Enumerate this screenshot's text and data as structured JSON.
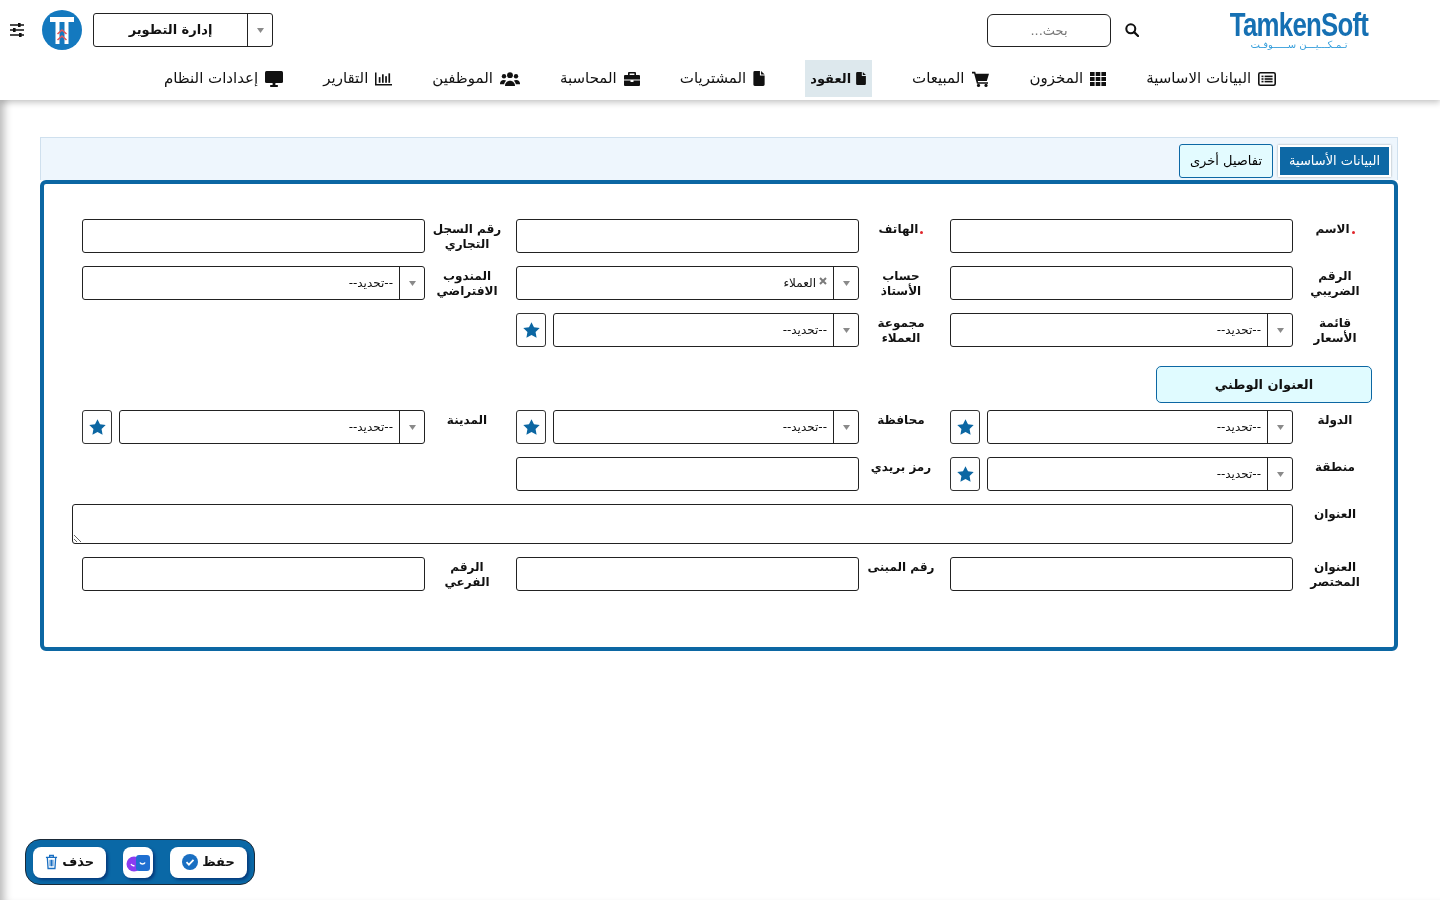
{
  "header": {
    "brand": {
      "name": "TamkenSoft",
      "tagline": "تـمـكـــيـــن ســـــوفـت"
    },
    "search": {
      "placeholder": "بحث..."
    },
    "department": {
      "value": "إدارة التطوير"
    }
  },
  "nav": [
    {
      "label": "البيانات الاساسية",
      "selected": false
    },
    {
      "label": "المخزون",
      "selected": false
    },
    {
      "label": "المبيعات",
      "selected": false
    },
    {
      "label": "العقود",
      "selected": true
    },
    {
      "label": "المشتريات",
      "selected": false
    },
    {
      "label": "المحاسبة",
      "selected": false
    },
    {
      "label": "الموظفين",
      "selected": false
    },
    {
      "label": "التقارير",
      "selected": false
    },
    {
      "label": "إعدادات النظام",
      "selected": false
    }
  ],
  "tabs": [
    {
      "label": "البيانات الأساسية",
      "selected": true
    },
    {
      "label": "تفاصيل أخرى",
      "selected": false
    }
  ],
  "form": {
    "groups": [
      {
        "rows": [
          [
            {
              "label": "الاسم",
              "kind": "input",
              "required": true
            },
            {
              "label": "الهاتف",
              "kind": "input",
              "required": true
            },
            {
              "label": "رقم السجل التجاري",
              "kind": "input",
              "required": false
            }
          ],
          [
            {
              "label": "الرقم الضريبي",
              "kind": "input",
              "required": false
            },
            {
              "label": "حساب الأستاذ",
              "kind": "select",
              "value": "العملاء",
              "required": false,
              "clearable": true,
              "star_button": false
            },
            {
              "label": "المندوب الافتراضي",
              "kind": "select",
              "value": "--تحديد--",
              "required": false,
              "clearable": false,
              "star_button": false
            }
          ],
          [
            {
              "label": "قائمة الأسعار",
              "kind": "select",
              "value": "--تحديد--",
              "required": false,
              "clearable": false,
              "star_button": false
            },
            {
              "label": "مجموعة العملاء",
              "kind": "select",
              "value": "--تحديد--",
              "required": false,
              "clearable": false,
              "star_button": true
            }
          ]
        ]
      },
      {
        "heading": "العنوان الوطني",
        "rows": [
          [
            {
              "label": "الدولة",
              "kind": "select",
              "value": "--تحديد--",
              "required": false,
              "clearable": false,
              "star_button": true
            },
            {
              "label": "محافظة",
              "kind": "select",
              "value": "--تحديد--",
              "required": false,
              "clearable": false,
              "star_button": true
            },
            {
              "label": "المدينة",
              "kind": "select",
              "value": "--تحديد--",
              "required": false,
              "clearable": false,
              "star_button": true
            }
          ],
          [
            {
              "label": "منطقة",
              "kind": "select",
              "value": "--تحديد--",
              "required": false,
              "clearable": false,
              "star_button": true
            },
            {
              "label": "رمز بريدي",
              "kind": "input",
              "required": false
            }
          ],
          [
            {
              "label": "العنوان",
              "kind": "textarea",
              "required": false
            }
          ],
          [
            {
              "label": "العنوان المختصر",
              "kind": "input",
              "required": false
            },
            {
              "label": "رقم المبنى",
              "kind": "input",
              "required": false
            },
            {
              "label": "الرقم الفرعي",
              "kind": "input",
              "required": false
            }
          ]
        ]
      }
    ]
  },
  "actions": [
    {
      "kind": "save",
      "label": "حفظ"
    },
    {
      "kind": "app"
    },
    {
      "kind": "delete",
      "label": "حذف"
    }
  ]
}
